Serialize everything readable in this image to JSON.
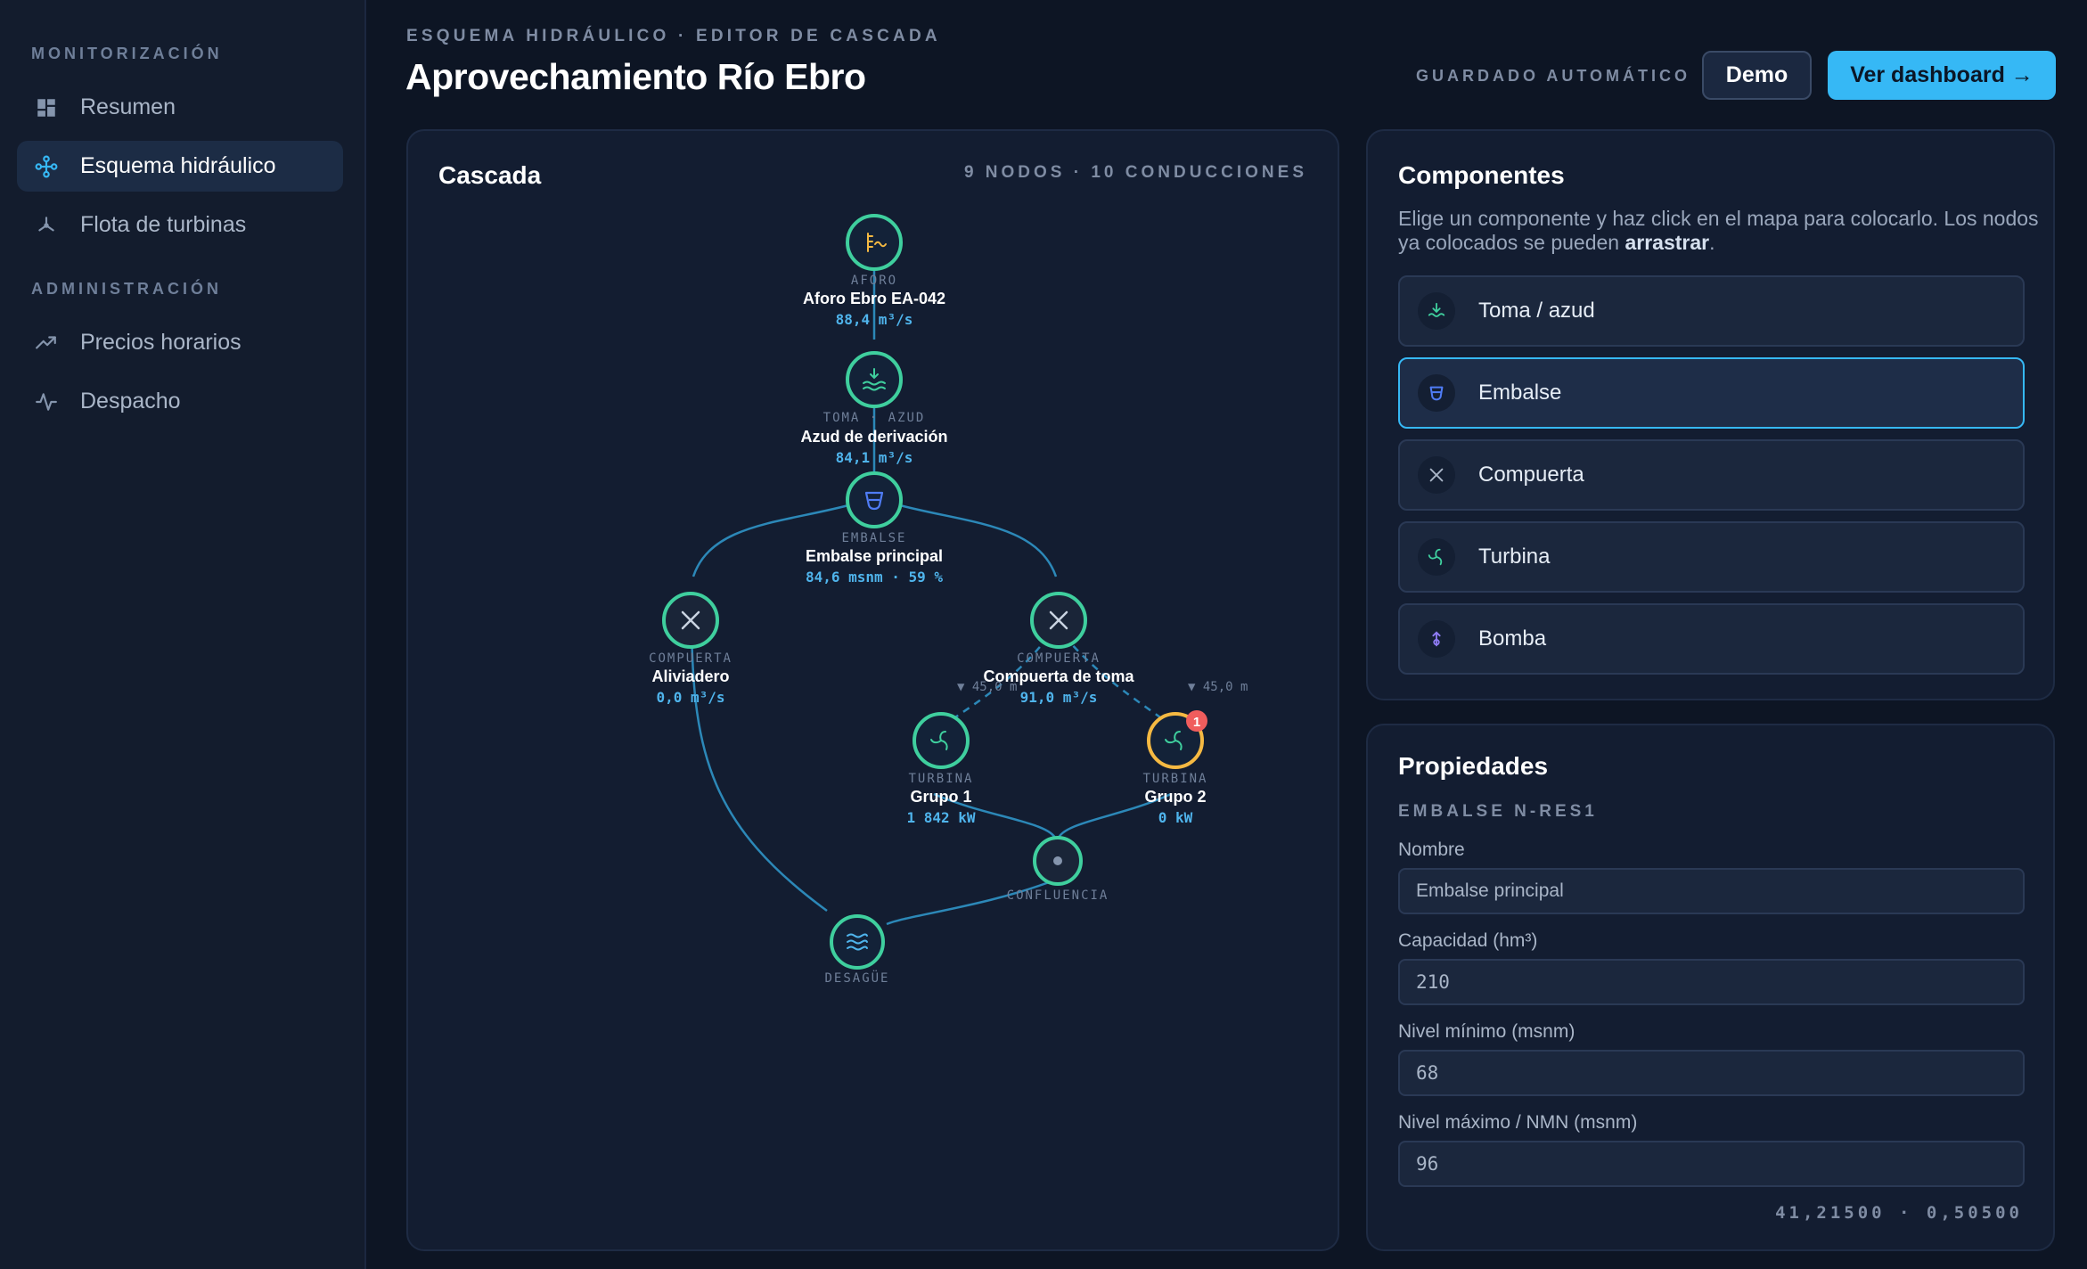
{
  "sidebar": {
    "sections": [
      {
        "title": "MONITORIZACIÓN",
        "items": [
          {
            "label": "Resumen",
            "icon": "grid-icon"
          },
          {
            "label": "Esquema hidráulico",
            "icon": "network-icon",
            "active": true
          },
          {
            "label": "Flota de turbinas",
            "icon": "turbine-icon"
          }
        ]
      },
      {
        "title": "ADMINISTRACIÓN",
        "items": [
          {
            "label": "Precios horarios",
            "icon": "trend-icon"
          },
          {
            "label": "Despacho",
            "icon": "pulse-icon"
          }
        ]
      }
    ]
  },
  "header": {
    "eyebrow": "ESQUEMA HIDRÁULICO · EDITOR DE CASCADA",
    "title": "Aprovechamiento Río Ebro",
    "autosave": "GUARDADO AUTOMÁTICO",
    "demo_label": "Demo",
    "dashboard_label": "Ver dashboard →"
  },
  "cascade": {
    "title": "Cascada",
    "meta": "9 NODOS · 10 CONDUCCIONES",
    "nodes": [
      {
        "id": "aforo",
        "type": "AFORO",
        "name": "Aforo Ebro EA-042",
        "value": "88,4 m³/s",
        "icon": "gauge-icon"
      },
      {
        "id": "toma",
        "type": "TOMA · AZUD",
        "name": "Azud de derivación",
        "value": "84,1 m³/s",
        "icon": "intake-icon"
      },
      {
        "id": "embalse",
        "type": "EMBALSE",
        "name": "Embalse principal",
        "value": "84,6 msnm · 59 %",
        "icon": "reservoir-icon"
      },
      {
        "id": "aliviadero",
        "type": "COMPUERTA",
        "name": "Aliviadero",
        "value": "0,0 m³/s",
        "icon": "gate-icon"
      },
      {
        "id": "comp_toma",
        "type": "COMPUERTA",
        "name": "Compuerta de toma",
        "value": "91,0 m³/s",
        "icon": "gate-icon"
      },
      {
        "id": "grupo1",
        "type": "TURBINA",
        "name": "Grupo 1",
        "value": "1 842 kW",
        "icon": "turbine-icon"
      },
      {
        "id": "grupo2",
        "type": "TURBINA",
        "name": "Grupo 2",
        "value": "0 kW",
        "icon": "turbine-icon",
        "warning": true,
        "badge": "1"
      },
      {
        "id": "confluencia",
        "type": "CONFLUENCIA",
        "name": "",
        "value": "",
        "icon": "dot-icon"
      },
      {
        "id": "desague",
        "type": "DESAGÜE",
        "name": "",
        "value": "",
        "icon": "outlet-icon"
      }
    ],
    "edge_labels": [
      {
        "id": "drop1",
        "text": "▼ 45,0 m"
      },
      {
        "id": "drop2",
        "text": "▼ 45,0 m"
      }
    ]
  },
  "components": {
    "title": "Componentes",
    "help_before": "Elige un componente y haz click en el mapa para colocarlo. Los nodos ya colocados se pueden ",
    "help_bold": "arrastrar",
    "help_after": ".",
    "items": [
      {
        "label": "Toma / azud",
        "icon": "intake-icon"
      },
      {
        "label": "Embalse",
        "icon": "reservoir-icon",
        "selected": true
      },
      {
        "label": "Compuerta",
        "icon": "gate-icon"
      },
      {
        "label": "Turbina",
        "icon": "turbine-icon"
      },
      {
        "label": "Bomba",
        "icon": "pump-icon"
      }
    ]
  },
  "properties": {
    "title": "Propiedades",
    "subtitle": "EMBALSE N-RES1",
    "fields": [
      {
        "label": "Nombre",
        "value": "Embalse principal"
      },
      {
        "label": "Capacidad (hm³)",
        "value": "210"
      },
      {
        "label": "Nivel mínimo (msnm)",
        "value": "68"
      },
      {
        "label": "Nivel máximo / NMN (msnm)",
        "value": "96"
      }
    ],
    "coords": "41,21500 · 0,50500"
  },
  "colors": {
    "accent": "#36b8f5",
    "node_ring": "#3fcf9e",
    "warning": "#f5b942",
    "badge": "#f05d5d",
    "edge": "#2c88b8"
  }
}
